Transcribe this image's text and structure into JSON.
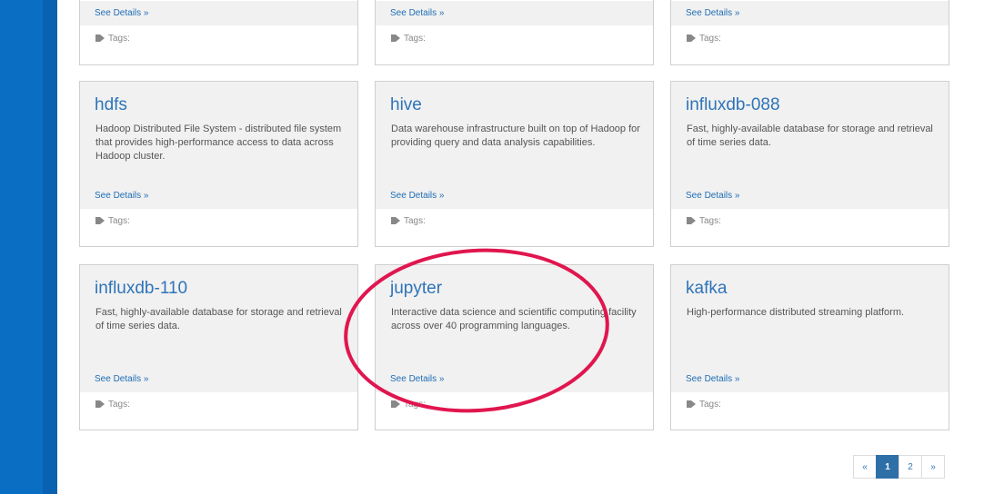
{
  "top_row": [
    {
      "details_label": "See Details »",
      "tags_label": "Tags:"
    },
    {
      "details_label": "See Details »",
      "tags_label": "Tags:"
    },
    {
      "details_label": "See Details »",
      "tags_label": "Tags:"
    }
  ],
  "cards": [
    {
      "title": "hdfs",
      "description": "Hadoop Distributed File System - distributed file system that provides high-performance access to data across Hadoop cluster.",
      "details_label": "See Details »",
      "tags_label": "Tags:"
    },
    {
      "title": "hive",
      "description": "Data warehouse infrastructure built on top of Hadoop for providing query and data analysis capabilities.",
      "details_label": "See Details »",
      "tags_label": "Tags:"
    },
    {
      "title": "influxdb-088",
      "description": "Fast, highly-available database for storage and retrieval of time series data.",
      "details_label": "See Details »",
      "tags_label": "Tags:"
    },
    {
      "title": "influxdb-110",
      "description": "Fast, highly-available database for storage and retrieval of time series data.",
      "details_label": "See Details »",
      "tags_label": "Tags:"
    },
    {
      "title": "jupyter",
      "description": "Interactive data science and scientific computing facility across over 40 programming languages.",
      "details_label": "See Details »",
      "tags_label": "Tags:"
    },
    {
      "title": "kafka",
      "description": "High-performance distributed streaming platform.",
      "details_label": "See Details »",
      "tags_label": "Tags:"
    }
  ],
  "pagination": {
    "prev": "«",
    "pages": [
      "1",
      "2"
    ],
    "active": "1",
    "next": "»"
  },
  "colors": {
    "accent": "#2e74b8",
    "annotation": "#e0164f",
    "sidebar": "#0a6fc2"
  }
}
